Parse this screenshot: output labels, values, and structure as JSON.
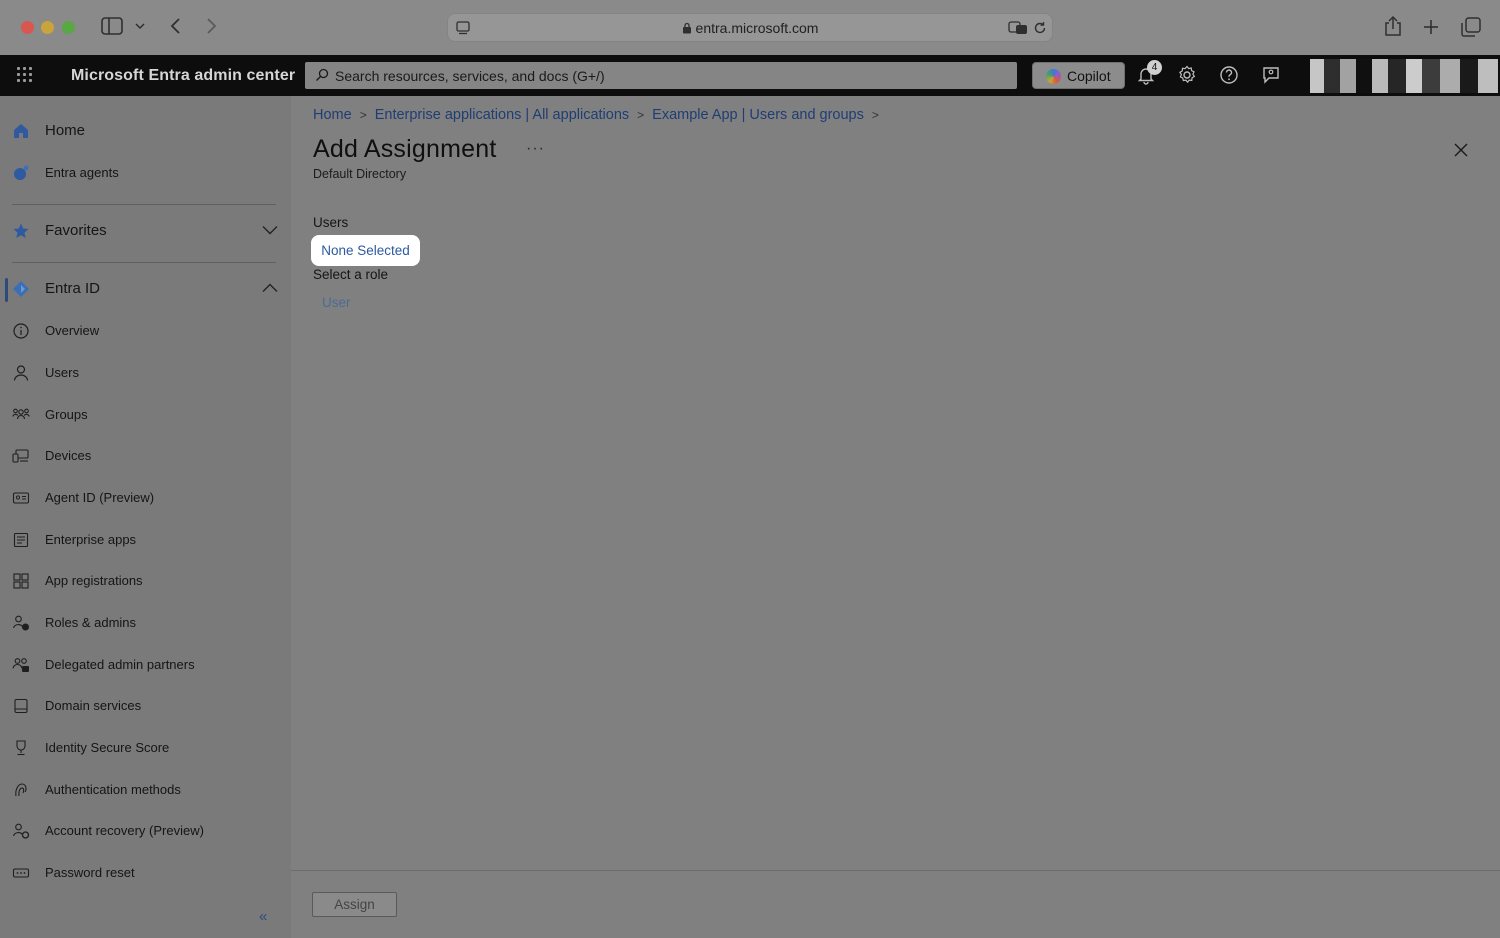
{
  "browser": {
    "url": "entra.microsoft.com"
  },
  "header": {
    "brand": "Microsoft Entra admin center",
    "search_placeholder": "Search resources, services, and docs (G+/)",
    "copilot_label": "Copilot",
    "notification_count": "4"
  },
  "sidebar": {
    "top_items": [
      {
        "label": "Home",
        "icon": "home-icon"
      },
      {
        "label": "Entra agents",
        "icon": "agents-icon"
      }
    ],
    "favorites_label": "Favorites",
    "section_label": "Entra ID",
    "items": [
      {
        "label": "Overview",
        "icon": "info-icon"
      },
      {
        "label": "Users",
        "icon": "user-icon"
      },
      {
        "label": "Groups",
        "icon": "groups-icon"
      },
      {
        "label": "Devices",
        "icon": "devices-icon"
      },
      {
        "label": "Agent ID (Preview)",
        "icon": "agent-id-icon"
      },
      {
        "label": "Enterprise apps",
        "icon": "enterprise-apps-icon"
      },
      {
        "label": "App registrations",
        "icon": "app-registrations-icon"
      },
      {
        "label": "Roles & admins",
        "icon": "roles-icon"
      },
      {
        "label": "Delegated admin partners",
        "icon": "partners-icon"
      },
      {
        "label": "Domain services",
        "icon": "domain-icon"
      },
      {
        "label": "Identity Secure Score",
        "icon": "trophy-icon"
      },
      {
        "label": "Authentication methods",
        "icon": "auth-methods-icon"
      },
      {
        "label": "Account recovery (Preview)",
        "icon": "account-recovery-icon"
      },
      {
        "label": "Password reset",
        "icon": "password-reset-icon"
      }
    ],
    "collapse_glyph": "«"
  },
  "main": {
    "breadcrumb": [
      "Home",
      "Enterprise applications | All applications",
      "Example App | Users and groups"
    ],
    "title": "Add Assignment",
    "more_glyph": "···",
    "subtitle": "Default Directory",
    "users_label": "Users",
    "users_value": "None Selected",
    "role_label": "Select a role",
    "role_value": "User",
    "assign_label": "Assign"
  },
  "colors": {
    "link": "#1e3e73",
    "portal_header": "#0d0d0d",
    "overlay_dim": "#808080"
  }
}
